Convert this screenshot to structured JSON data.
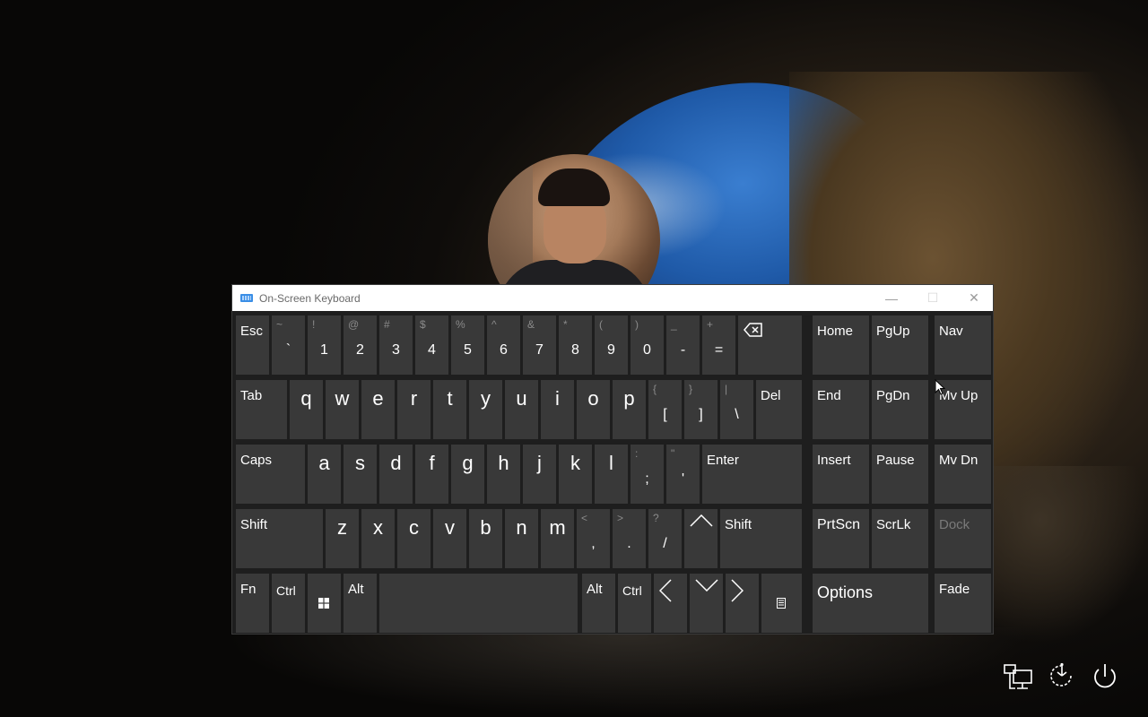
{
  "window": {
    "title": "On-Screen Keyboard",
    "minimize": "—",
    "maximize": "☐",
    "close": "✕"
  },
  "keys": {
    "esc": "Esc",
    "row1": [
      {
        "shift": "~",
        "base": "`"
      },
      {
        "shift": "!",
        "base": "1"
      },
      {
        "shift": "@",
        "base": "2"
      },
      {
        "shift": "#",
        "base": "3"
      },
      {
        "shift": "$",
        "base": "4"
      },
      {
        "shift": "%",
        "base": "5"
      },
      {
        "shift": "^",
        "base": "6"
      },
      {
        "shift": "&",
        "base": "7"
      },
      {
        "shift": "*",
        "base": "8"
      },
      {
        "shift": "(",
        "base": "9"
      },
      {
        "shift": ")",
        "base": "0"
      },
      {
        "shift": "_",
        "base": "-"
      },
      {
        "shift": "+",
        "base": "="
      }
    ],
    "tab": "Tab",
    "row2": [
      "q",
      "w",
      "e",
      "r",
      "t",
      "y",
      "u",
      "i",
      "o",
      "p"
    ],
    "row2sym": [
      {
        "shift": "{",
        "base": "["
      },
      {
        "shift": "}",
        "base": "]"
      },
      {
        "shift": "|",
        "base": "\\"
      }
    ],
    "del": "Del",
    "caps": "Caps",
    "row3": [
      "a",
      "s",
      "d",
      "f",
      "g",
      "h",
      "j",
      "k",
      "l"
    ],
    "row3sym": [
      {
        "shift": ":",
        "base": ";"
      },
      {
        "shift": "\"",
        "base": "'"
      }
    ],
    "enter": "Enter",
    "shift": "Shift",
    "row4": [
      "z",
      "x",
      "c",
      "v",
      "b",
      "n",
      "m"
    ],
    "row4sym": [
      {
        "shift": "<",
        "base": ","
      },
      {
        "shift": ">",
        "base": "."
      },
      {
        "shift": "?",
        "base": "/"
      }
    ],
    "shift_right": "Shift",
    "fn": "Fn",
    "ctrl": "Ctrl",
    "alt": "Alt",
    "alt_right": "Alt",
    "ctrl_right": "Ctrl",
    "nav": {
      "home": "Home",
      "pgup": "PgUp",
      "nav": "Nav",
      "end": "End",
      "pgdn": "PgDn",
      "mvup": "Mv Up",
      "insert": "Insert",
      "pause": "Pause",
      "mvdn": "Mv Dn",
      "prtscn": "PrtScn",
      "scrlk": "ScrLk",
      "dock": "Dock",
      "options": "Options",
      "fade": "Fade"
    }
  },
  "colors": {
    "key": "#393939",
    "window": "#1e1e1e",
    "text": "#ffffff",
    "dimmed": "#7a7a7a",
    "titlebar": "#ffffff"
  },
  "system_icons": [
    "network-icon",
    "ease-of-access-icon",
    "power-icon"
  ]
}
